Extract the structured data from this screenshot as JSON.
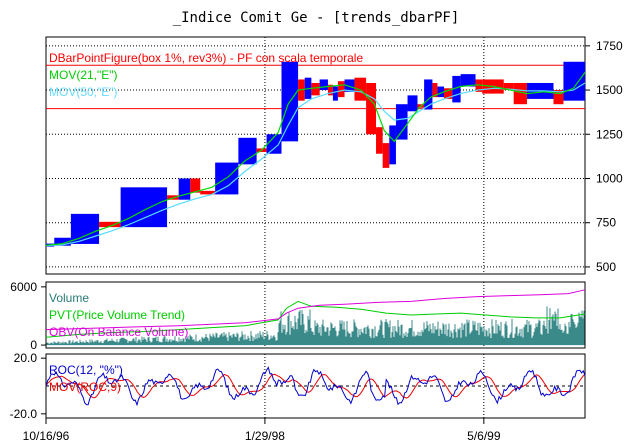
{
  "chart_data": {
    "type": "financial-multi-panel",
    "title": "_Indice Comit Ge   -   [trends_dbarPF]",
    "colors": {
      "up": "#0000ff",
      "down": "#ff0000",
      "mov21": "#00dd00",
      "mov50": "#55ddff",
      "volume": "#3a8a8a",
      "pvt": "#00cc00",
      "obv": "#dd00dd",
      "roc": "#0000cc",
      "movroc": "#ee0000",
      "hline": "#ff0000"
    },
    "x_ticks": [
      "10/16/96",
      "1/29/98",
      "5/6/99"
    ],
    "price_panel": {
      "legend": [
        "DBarPointFigure(box 1%, rev3%) - PF con scala temporale",
        "MOV(21,\"E\")",
        "MOV(50,\"E\")"
      ],
      "y_ticks": [
        500,
        750,
        1000,
        1250,
        1500,
        1750
      ],
      "ylim": [
        460,
        1800
      ],
      "hlines": [
        1640,
        1395
      ],
      "boxes": [
        {
          "x0": 0,
          "x1": 5,
          "lo": 615,
          "hi": 632,
          "dir": "up"
        },
        {
          "x0": 5,
          "x1": 15,
          "lo": 620,
          "hi": 665,
          "dir": "up"
        },
        {
          "x0": 15,
          "x1": 32,
          "lo": 630,
          "hi": 800,
          "dir": "up"
        },
        {
          "x0": 32,
          "x1": 45,
          "lo": 725,
          "hi": 755,
          "dir": "down"
        },
        {
          "x0": 45,
          "x1": 73,
          "lo": 725,
          "hi": 950,
          "dir": "up"
        },
        {
          "x0": 73,
          "x1": 80,
          "lo": 880,
          "hi": 905,
          "dir": "down"
        },
        {
          "x0": 80,
          "x1": 87,
          "lo": 880,
          "hi": 1000,
          "dir": "up"
        },
        {
          "x0": 87,
          "x1": 93,
          "lo": 920,
          "hi": 1000,
          "dir": "down"
        },
        {
          "x0": 93,
          "x1": 102,
          "lo": 910,
          "hi": 930,
          "dir": "down"
        },
        {
          "x0": 102,
          "x1": 116,
          "lo": 910,
          "hi": 1090,
          "dir": "up"
        },
        {
          "x0": 116,
          "x1": 127,
          "lo": 1080,
          "hi": 1230,
          "dir": "up"
        },
        {
          "x0": 127,
          "x1": 133,
          "lo": 1150,
          "hi": 1170,
          "dir": "down"
        },
        {
          "x0": 133,
          "x1": 142,
          "lo": 1140,
          "hi": 1250,
          "dir": "up"
        },
        {
          "x0": 142,
          "x1": 152,
          "lo": 1210,
          "hi": 1660,
          "dir": "up"
        },
        {
          "x0": 152,
          "x1": 156,
          "lo": 1440,
          "hi": 1560,
          "dir": "down"
        },
        {
          "x0": 156,
          "x1": 160,
          "lo": 1450,
          "hi": 1570,
          "dir": "up"
        },
        {
          "x0": 160,
          "x1": 165,
          "lo": 1470,
          "hi": 1540,
          "dir": "down"
        },
        {
          "x0": 165,
          "x1": 170,
          "lo": 1500,
          "hi": 1560,
          "dir": "up"
        },
        {
          "x0": 170,
          "x1": 173,
          "lo": 1470,
          "hi": 1530,
          "dir": "down"
        },
        {
          "x0": 173,
          "x1": 176,
          "lo": 1440,
          "hi": 1520,
          "dir": "up"
        },
        {
          "x0": 176,
          "x1": 180,
          "lo": 1460,
          "hi": 1550,
          "dir": "down"
        },
        {
          "x0": 180,
          "x1": 186,
          "lo": 1490,
          "hi": 1560,
          "dir": "up"
        },
        {
          "x0": 186,
          "x1": 193,
          "lo": 1440,
          "hi": 1570,
          "dir": "down"
        },
        {
          "x0": 193,
          "x1": 199,
          "lo": 1250,
          "hi": 1540,
          "dir": "down"
        },
        {
          "x0": 199,
          "x1": 203,
          "lo": 1140,
          "hi": 1290,
          "dir": "down"
        },
        {
          "x0": 203,
          "x1": 207,
          "lo": 1060,
          "hi": 1200,
          "dir": "down"
        },
        {
          "x0": 207,
          "x1": 211,
          "lo": 1080,
          "hi": 1300,
          "dir": "up"
        },
        {
          "x0": 211,
          "x1": 218,
          "lo": 1220,
          "hi": 1420,
          "dir": "up"
        },
        {
          "x0": 218,
          "x1": 224,
          "lo": 1380,
          "hi": 1470,
          "dir": "up"
        },
        {
          "x0": 224,
          "x1": 228,
          "lo": 1400,
          "hi": 1420,
          "dir": "down"
        },
        {
          "x0": 228,
          "x1": 233,
          "lo": 1390,
          "hi": 1560,
          "dir": "up"
        },
        {
          "x0": 233,
          "x1": 236,
          "lo": 1460,
          "hi": 1540,
          "dir": "down"
        },
        {
          "x0": 236,
          "x1": 240,
          "lo": 1460,
          "hi": 1520,
          "dir": "up"
        },
        {
          "x0": 240,
          "x1": 245,
          "lo": 1450,
          "hi": 1510,
          "dir": "down"
        },
        {
          "x0": 245,
          "x1": 250,
          "lo": 1430,
          "hi": 1580,
          "dir": "up"
        },
        {
          "x0": 250,
          "x1": 259,
          "lo": 1520,
          "hi": 1590,
          "dir": "up"
        },
        {
          "x0": 259,
          "x1": 263,
          "lo": 1490,
          "hi": 1560,
          "dir": "down"
        },
        {
          "x0": 263,
          "x1": 276,
          "lo": 1480,
          "hi": 1560,
          "dir": "down"
        },
        {
          "x0": 276,
          "x1": 282,
          "lo": 1500,
          "hi": 1540,
          "dir": "down"
        },
        {
          "x0": 282,
          "x1": 290,
          "lo": 1420,
          "hi": 1540,
          "dir": "down"
        },
        {
          "x0": 290,
          "x1": 306,
          "lo": 1450,
          "hi": 1540,
          "dir": "up"
        },
        {
          "x0": 306,
          "x1": 312,
          "lo": 1420,
          "hi": 1500,
          "dir": "down"
        },
        {
          "x0": 312,
          "x1": 325,
          "lo": 1440,
          "hi": 1660,
          "dir": "up"
        }
      ],
      "mov21": [
        [
          0,
          622
        ],
        [
          10,
          632
        ],
        [
          20,
          662
        ],
        [
          30,
          702
        ],
        [
          40,
          735
        ],
        [
          50,
          775
        ],
        [
          60,
          825
        ],
        [
          70,
          870
        ],
        [
          80,
          900
        ],
        [
          90,
          925
        ],
        [
          100,
          950
        ],
        [
          110,
          1010
        ],
        [
          120,
          1100
        ],
        [
          130,
          1160
        ],
        [
          140,
          1260
        ],
        [
          146,
          1420
        ],
        [
          152,
          1500
        ],
        [
          160,
          1510
        ],
        [
          170,
          1520
        ],
        [
          180,
          1530
        ],
        [
          190,
          1500
        ],
        [
          198,
          1420
        ],
        [
          204,
          1270
        ],
        [
          210,
          1210
        ],
        [
          218,
          1310
        ],
        [
          225,
          1400
        ],
        [
          232,
          1460
        ],
        [
          240,
          1490
        ],
        [
          250,
          1520
        ],
        [
          260,
          1530
        ],
        [
          270,
          1520
        ],
        [
          280,
          1500
        ],
        [
          290,
          1480
        ],
        [
          300,
          1490
        ],
        [
          310,
          1480
        ],
        [
          318,
          1510
        ],
        [
          325,
          1600
        ]
      ],
      "mov50": [
        [
          0,
          620
        ],
        [
          10,
          625
        ],
        [
          20,
          645
        ],
        [
          30,
          675
        ],
        [
          40,
          705
        ],
        [
          50,
          740
        ],
        [
          60,
          780
        ],
        [
          70,
          820
        ],
        [
          80,
          855
        ],
        [
          90,
          885
        ],
        [
          100,
          910
        ],
        [
          110,
          960
        ],
        [
          120,
          1040
        ],
        [
          130,
          1110
        ],
        [
          140,
          1190
        ],
        [
          146,
          1300
        ],
        [
          152,
          1400
        ],
        [
          160,
          1450
        ],
        [
          170,
          1480
        ],
        [
          180,
          1500
        ],
        [
          190,
          1490
        ],
        [
          198,
          1450
        ],
        [
          204,
          1380
        ],
        [
          210,
          1330
        ],
        [
          218,
          1340
        ],
        [
          225,
          1380
        ],
        [
          232,
          1420
        ],
        [
          240,
          1450
        ],
        [
          250,
          1480
        ],
        [
          260,
          1500
        ],
        [
          270,
          1510
        ],
        [
          280,
          1505
        ],
        [
          290,
          1495
        ],
        [
          300,
          1495
        ],
        [
          310,
          1490
        ],
        [
          318,
          1500
        ],
        [
          325,
          1540
        ]
      ]
    },
    "volume_panel": {
      "legend": [
        "Volume",
        "PVT(Price Volume Trend)",
        "OBV(On Balance Volume)"
      ],
      "y_ticks": [
        0,
        6000
      ],
      "ylim": [
        -300,
        6500
      ],
      "pvt": [
        [
          0,
          800
        ],
        [
          20,
          1100
        ],
        [
          40,
          1300
        ],
        [
          60,
          1400
        ],
        [
          80,
          1600
        ],
        [
          100,
          1800
        ],
        [
          120,
          2000
        ],
        [
          140,
          2600
        ],
        [
          145,
          3800
        ],
        [
          152,
          4500
        ],
        [
          160,
          4000
        ],
        [
          175,
          3900
        ],
        [
          190,
          3700
        ],
        [
          205,
          3300
        ],
        [
          220,
          3100
        ],
        [
          235,
          3200
        ],
        [
          250,
          3300
        ],
        [
          265,
          3100
        ],
        [
          280,
          2900
        ],
        [
          295,
          2800
        ],
        [
          310,
          2800
        ],
        [
          325,
          3200
        ]
      ],
      "obv": [
        [
          0,
          1600
        ],
        [
          20,
          1700
        ],
        [
          40,
          1800
        ],
        [
          60,
          1900
        ],
        [
          80,
          2000
        ],
        [
          100,
          2150
        ],
        [
          120,
          2300
        ],
        [
          140,
          2700
        ],
        [
          145,
          3300
        ],
        [
          152,
          3800
        ],
        [
          165,
          4100
        ],
        [
          180,
          4200
        ],
        [
          200,
          4400
        ],
        [
          220,
          4500
        ],
        [
          240,
          4800
        ],
        [
          260,
          5000
        ],
        [
          280,
          5100
        ],
        [
          300,
          5200
        ],
        [
          315,
          5300
        ],
        [
          325,
          5700
        ]
      ]
    },
    "roc_panel": {
      "legend": [
        "ROC(12, \"%\")",
        "MOV(ROC,9)"
      ],
      "y_ticks": [
        20.0,
        -20.0
      ],
      "ylim": [
        -23,
        23
      ]
    }
  }
}
